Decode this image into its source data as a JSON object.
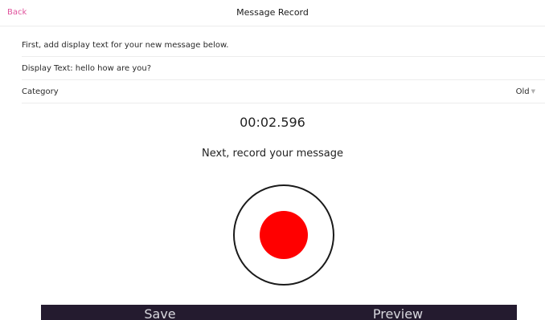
{
  "colors": {
    "accent": "#e0529c",
    "record_red": "#ff0000",
    "bar_dark": "#241b2f"
  },
  "nav": {
    "back_label": "Back",
    "title": "Message Record"
  },
  "form": {
    "instruction": "First, add display text for your new message below.",
    "display_text": "Display Text: hello how are you?",
    "category_label": "Category",
    "category_value": "Old",
    "category_chevron": "chevron-down-icon"
  },
  "recorder": {
    "timer": "00:02.596",
    "prompt": "Next, record your message",
    "record_icon": "record-icon"
  },
  "bottom_bar": {
    "save_label": "Save",
    "preview_label": "Preview"
  }
}
